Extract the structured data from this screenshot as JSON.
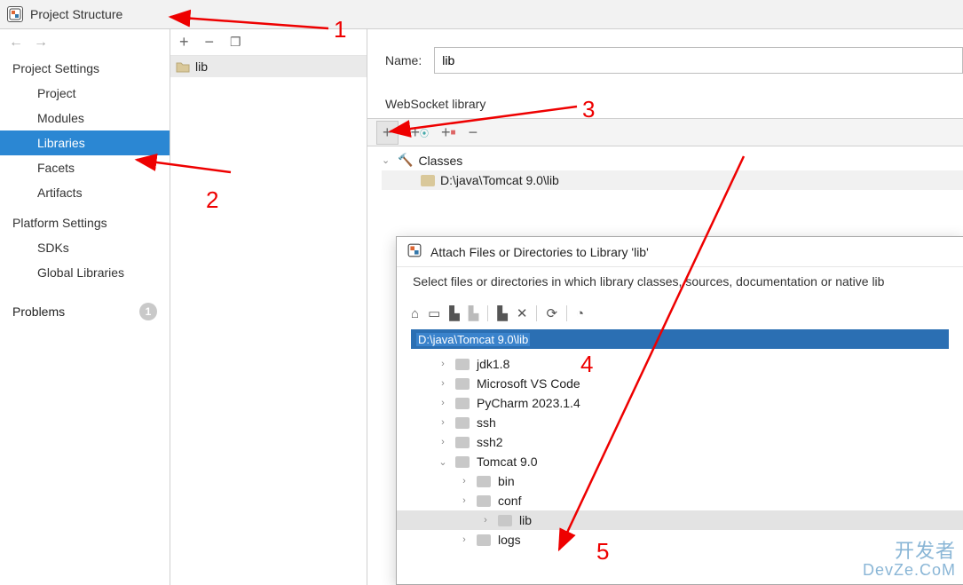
{
  "window": {
    "title": "Project Structure"
  },
  "nav": {
    "project_settings": "Project Settings",
    "items_ps": [
      "Project",
      "Modules",
      "Libraries",
      "Facets",
      "Artifacts"
    ],
    "selected_ps_index": 2,
    "platform_settings": "Platform Settings",
    "items_pf": [
      "SDKs",
      "Global Libraries"
    ],
    "problems_label": "Problems",
    "problems_count": "1"
  },
  "mid": {
    "list": [
      "lib"
    ]
  },
  "right": {
    "name_label": "Name:",
    "name_value": "lib",
    "section_label": "WebSocket library",
    "tree": {
      "root": "Classes",
      "item0": "D:\\java\\Tomcat 9.0\\lib"
    }
  },
  "dialog": {
    "title": "Attach Files or Directories to Library 'lib'",
    "message": "Select files or directories in which library classes, sources, documentation or native lib",
    "path": "D:\\java\\Tomcat 9.0\\lib",
    "tree": [
      {
        "label": "jdk1.8",
        "indent": 0,
        "exp": "›"
      },
      {
        "label": "Microsoft VS Code",
        "indent": 0,
        "exp": "›"
      },
      {
        "label": "PyCharm 2023.1.4",
        "indent": 0,
        "exp": "›"
      },
      {
        "label": "ssh",
        "indent": 0,
        "exp": "›"
      },
      {
        "label": "ssh2",
        "indent": 0,
        "exp": "›"
      },
      {
        "label": "Tomcat 9.0",
        "indent": 0,
        "exp": "⌄",
        "expanded": true
      },
      {
        "label": "bin",
        "indent": 1,
        "exp": "›"
      },
      {
        "label": "conf",
        "indent": 1,
        "exp": "›"
      },
      {
        "label": "lib",
        "indent": 1,
        "exp": "›",
        "selected": true
      },
      {
        "label": "logs",
        "indent": 1,
        "exp": "›"
      }
    ]
  },
  "annotations": {
    "n1": "1",
    "n2": "2",
    "n3": "3",
    "n4": "4",
    "n5": "5"
  },
  "watermark": {
    "line1": "开发者",
    "line2": "DevZe.CoM"
  }
}
